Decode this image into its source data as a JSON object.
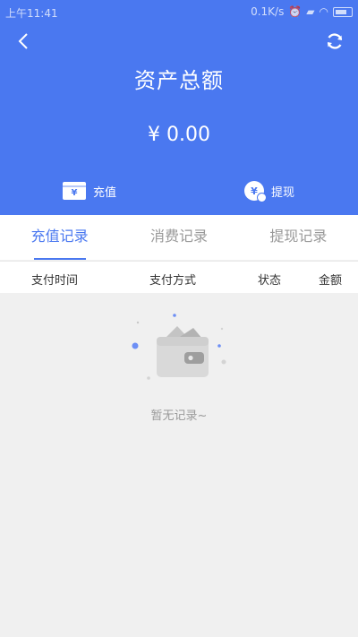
{
  "status_bar": {
    "time": "上午11:41",
    "speed": "0.1K/s"
  },
  "header": {
    "title": "资产总额",
    "amount": "¥ 0.00",
    "back_icon": "chevron-left-icon",
    "refresh_icon": "refresh-icon",
    "background_color": "#4a78f0"
  },
  "actions": {
    "recharge_label": "充值",
    "withdraw_label": "提现",
    "currency_glyph": "¥"
  },
  "tabs": [
    {
      "label": "充值记录",
      "active": true
    },
    {
      "label": "消费记录",
      "active": false
    },
    {
      "label": "提现记录",
      "active": false
    }
  ],
  "columns": {
    "time": "支付时间",
    "method": "支付方式",
    "status": "状态",
    "amount": "金额"
  },
  "empty_state": {
    "message": "暂无记录~",
    "icon": "empty-wallet-icon"
  }
}
